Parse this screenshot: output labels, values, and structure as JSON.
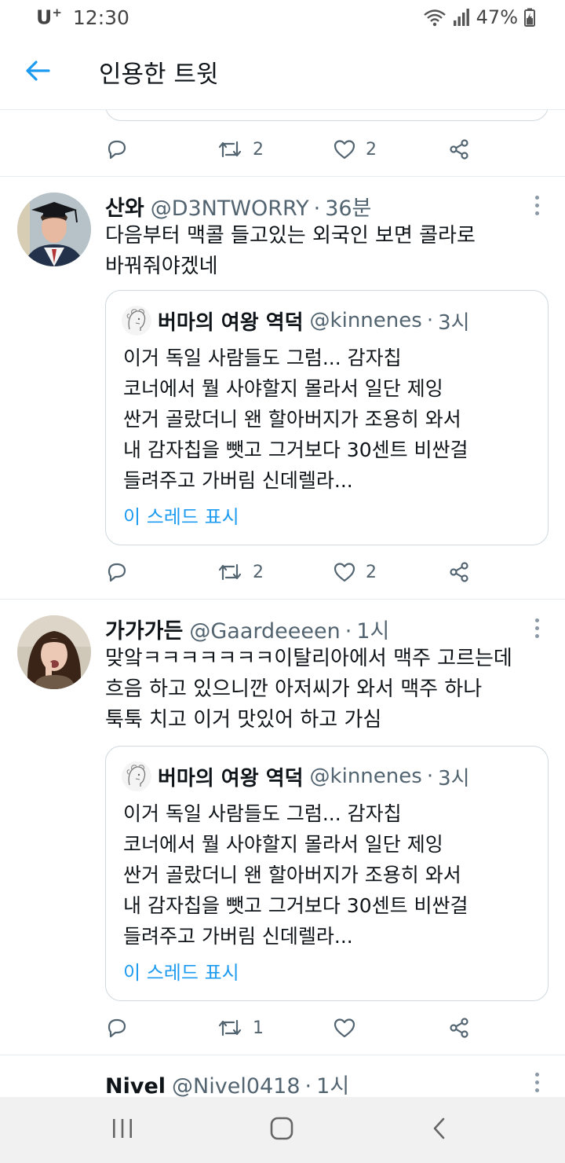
{
  "status_bar": {
    "carrier": "U",
    "carrier_mark": "+",
    "time": "12:30",
    "battery": "47%"
  },
  "header": {
    "title": "인용한 트윗"
  },
  "colors": {
    "accent": "#1d9bf0",
    "secondary_text": "#536471",
    "border": "#cfd9de"
  },
  "previous_tweet": {
    "retweets": "2",
    "likes": "2"
  },
  "tweets": [
    {
      "name": "산와",
      "handle": "@D3NTWORRY",
      "dot": "·",
      "time": "36분",
      "text_lines": [
        "다음부터 맥콜 들고있는 외국인 보면 콜라로",
        "바꿔줘야겠네"
      ],
      "quote": {
        "name": "버마의 여왕 역덕",
        "handle": "@kinnenes",
        "dot": "·",
        "time": "3시",
        "text_lines": [
          "이거 독일 사람들도 그럼... 감자칩",
          "코너에서 뭘 사야할지 몰라서 일단 제잉",
          "싼거 골랐더니 왠 할아버지가 조용히 와서",
          "내 감자칩을 뺏고 그거보다 30센트 비싼걸",
          "들려주고 가버림 신데렐라..."
        ],
        "show_thread": "이 스레드 표시"
      },
      "retweets": "2",
      "likes": "2"
    },
    {
      "name": "가가가든",
      "handle": "@Gaardeeeen",
      "dot": "·",
      "time": "1시",
      "text_lines": [
        "맞앜ㅋㅋㅋㅋㅋㅋㅋ이탈리아에서 맥주 고르는데",
        "흐음 하고 있으니깐 아저씨가 와서 맥주 하나",
        "툭툭 치고 이거 맛있어 하고 가심"
      ],
      "quote": {
        "name": "버마의 여왕 역덕",
        "handle": "@kinnenes",
        "dot": "·",
        "time": "3시",
        "text_lines": [
          "이거 독일 사람들도 그럼... 감자칩",
          "코너에서 뭘 사야할지 몰라서 일단 제잉",
          "싼거 골랐더니 왠 할아버지가 조용히 와서",
          "내 감자칩을 뺏고 그거보다 30센트 비싼걸",
          "들려주고 가버림 신데렐라..."
        ],
        "show_thread": "이 스레드 표시"
      },
      "retweets": "1",
      "likes": ""
    },
    {
      "name": "Nivel",
      "handle": "@Nivel0418",
      "dot": "·",
      "time": "1시"
    }
  ],
  "icons": {
    "back": "arrow-left-icon",
    "reply": "reply-icon",
    "retweet": "retweet-icon",
    "like": "heart-icon",
    "share": "share-icon",
    "more": "more-vertical-icon",
    "wifi": "wifi-icon",
    "signal": "signal-icon",
    "battery": "battery-icon",
    "nav_recents": "recents-icon",
    "nav_home": "home-icon",
    "nav_back": "nav-back-icon"
  }
}
